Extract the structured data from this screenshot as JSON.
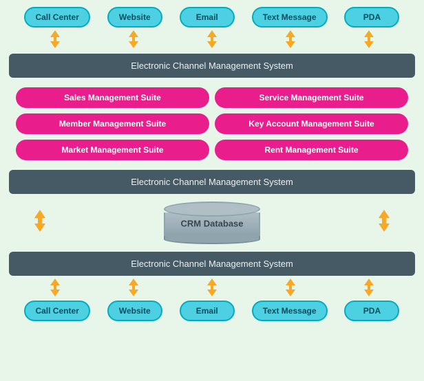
{
  "top_channels": [
    "Call Center",
    "Website",
    "Email",
    "Text Message",
    "PDA"
  ],
  "bottom_channels": [
    "Call Center",
    "Website",
    "Email",
    "Text Message",
    "PDA"
  ],
  "ecms_label": "Electronic Channel Management System",
  "ecms_label2": "Electronic Channel Management System",
  "ecms_label3": "Electronic Channel Management System",
  "suites": [
    "Sales Management Suite",
    "Service Management Suite",
    "Member Management Suite",
    "Key Account Management Suite",
    "Market Management Suite",
    "Rent Management Suite"
  ],
  "crm_label": "CRM Database",
  "arrow_symbol": "⬆⬇"
}
